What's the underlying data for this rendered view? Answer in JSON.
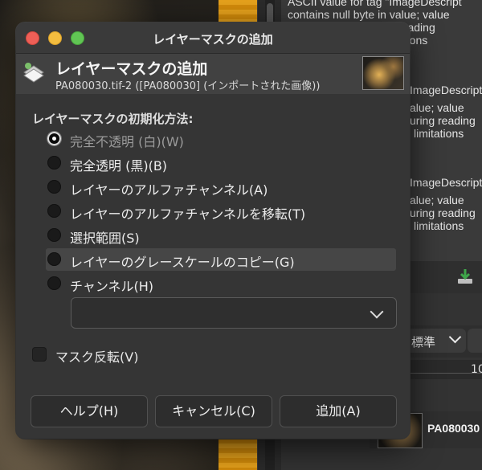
{
  "background": {
    "log_lines": [
      "ASCII value for tag \"ImageDescript",
      "contains null byte in value; value",
      "uring reading",
      "limitations",
      "ImageDescript",
      "alue; value",
      "uring reading",
      "limitations",
      "ImageDescript",
      "alue; value",
      "uring reading",
      "limitations"
    ],
    "mode_select": "標準",
    "scale_number": "10",
    "layer_name": "PA080030"
  },
  "dialog": {
    "window_title": "レイヤーマスクの追加",
    "header_title": "レイヤーマスクの追加",
    "header_subtitle": "PA080030.tif-2 ([PA080030] (インポートされた画像))",
    "section_label": "レイヤーマスクの初期化方法:",
    "options": [
      {
        "label": "完全不透明 (白)(W)",
        "selected": true
      },
      {
        "label": "完全透明 (黒)(B)",
        "selected": false
      },
      {
        "label": "レイヤーのアルファチャンネル(A)",
        "selected": false
      },
      {
        "label": "レイヤーのアルファチャンネルを移転(T)",
        "selected": false
      },
      {
        "label": "選択範囲(S)",
        "selected": false
      },
      {
        "label": "レイヤーのグレースケールのコピー(G)",
        "selected": false
      },
      {
        "label": "チャンネル(H)",
        "selected": false
      }
    ],
    "channel_value": "",
    "invert_label": "マスク反転(V)",
    "buttons": {
      "help": "ヘルプ(H)",
      "cancel": "キャンセル(C)",
      "add": "追加(A)"
    }
  },
  "colors": {
    "dialog_bg": "#353535",
    "close": "#ee5f57",
    "minimize": "#f4bd3f",
    "zoom": "#61c554"
  }
}
